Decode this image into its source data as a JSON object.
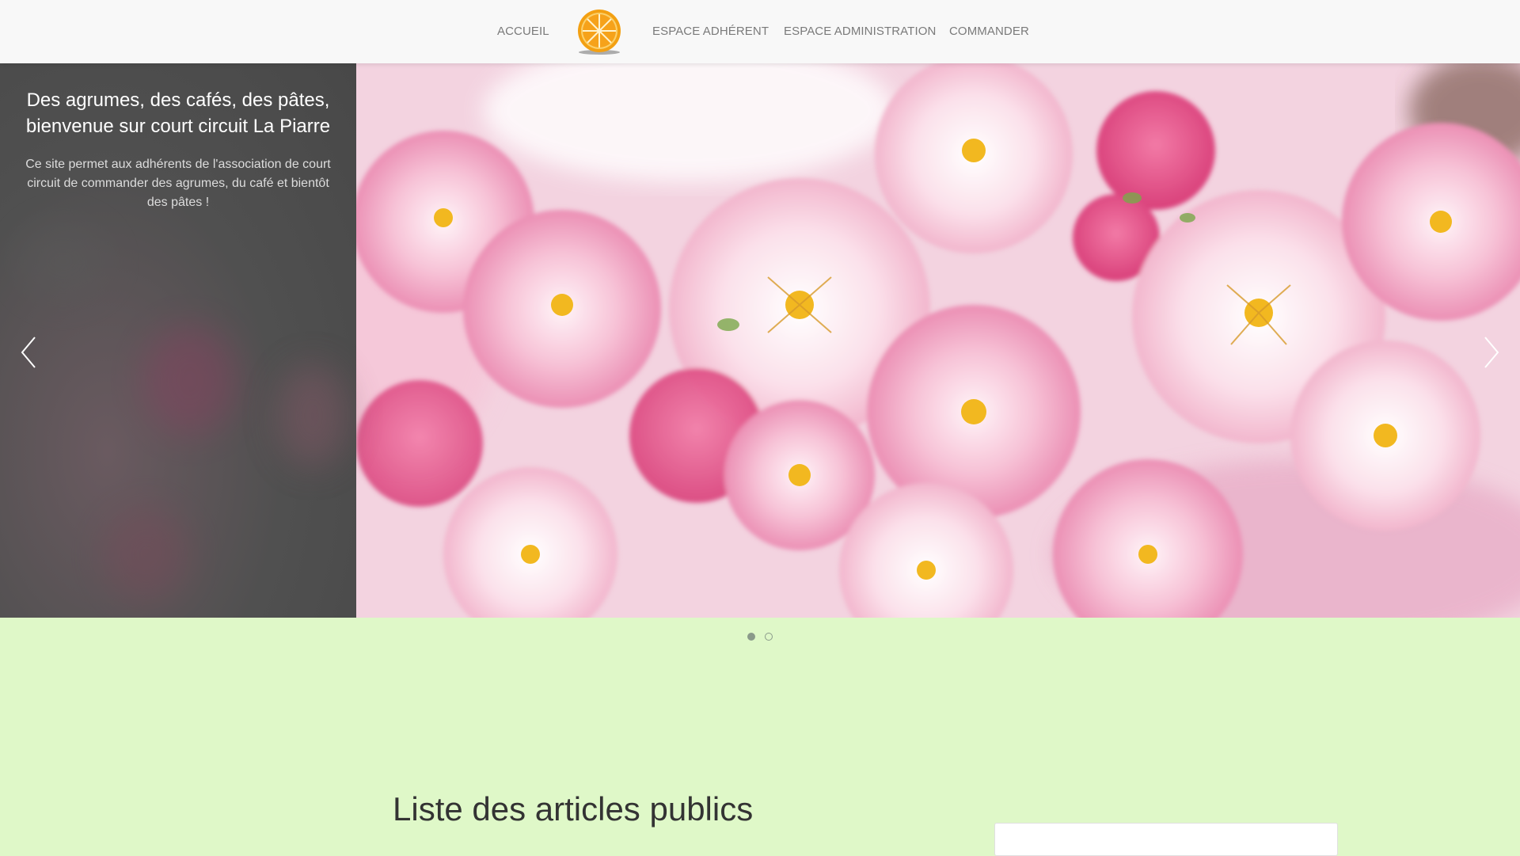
{
  "nav": {
    "items": [
      {
        "label": "ACCUEIL"
      },
      {
        "label": "ESPACE ADHÉRENT"
      },
      {
        "label": "ESPACE ADMINISTRATION"
      },
      {
        "label": "COMMANDER"
      }
    ],
    "logo_icon": "orange-slice-icon"
  },
  "hero": {
    "title": "Des agrumes, des cafés, des pâtes, bienvenue sur court circuit La Piarre",
    "text": "Ce site permet aux adhérents de l'association de court circuit de commander des agrumes, du café et bientôt des pâtes !",
    "prev_icon": "chevron-left-icon",
    "next_icon": "chevron-right-icon",
    "slides_count": 2,
    "active_slide": 1
  },
  "main": {
    "section_title": "Liste des articles publics"
  },
  "colors": {
    "page_background": "#dff8c8",
    "navbar_background": "#f8f8f8",
    "nav_text": "#7a7a7a",
    "logo_orange": "#f39c12"
  }
}
